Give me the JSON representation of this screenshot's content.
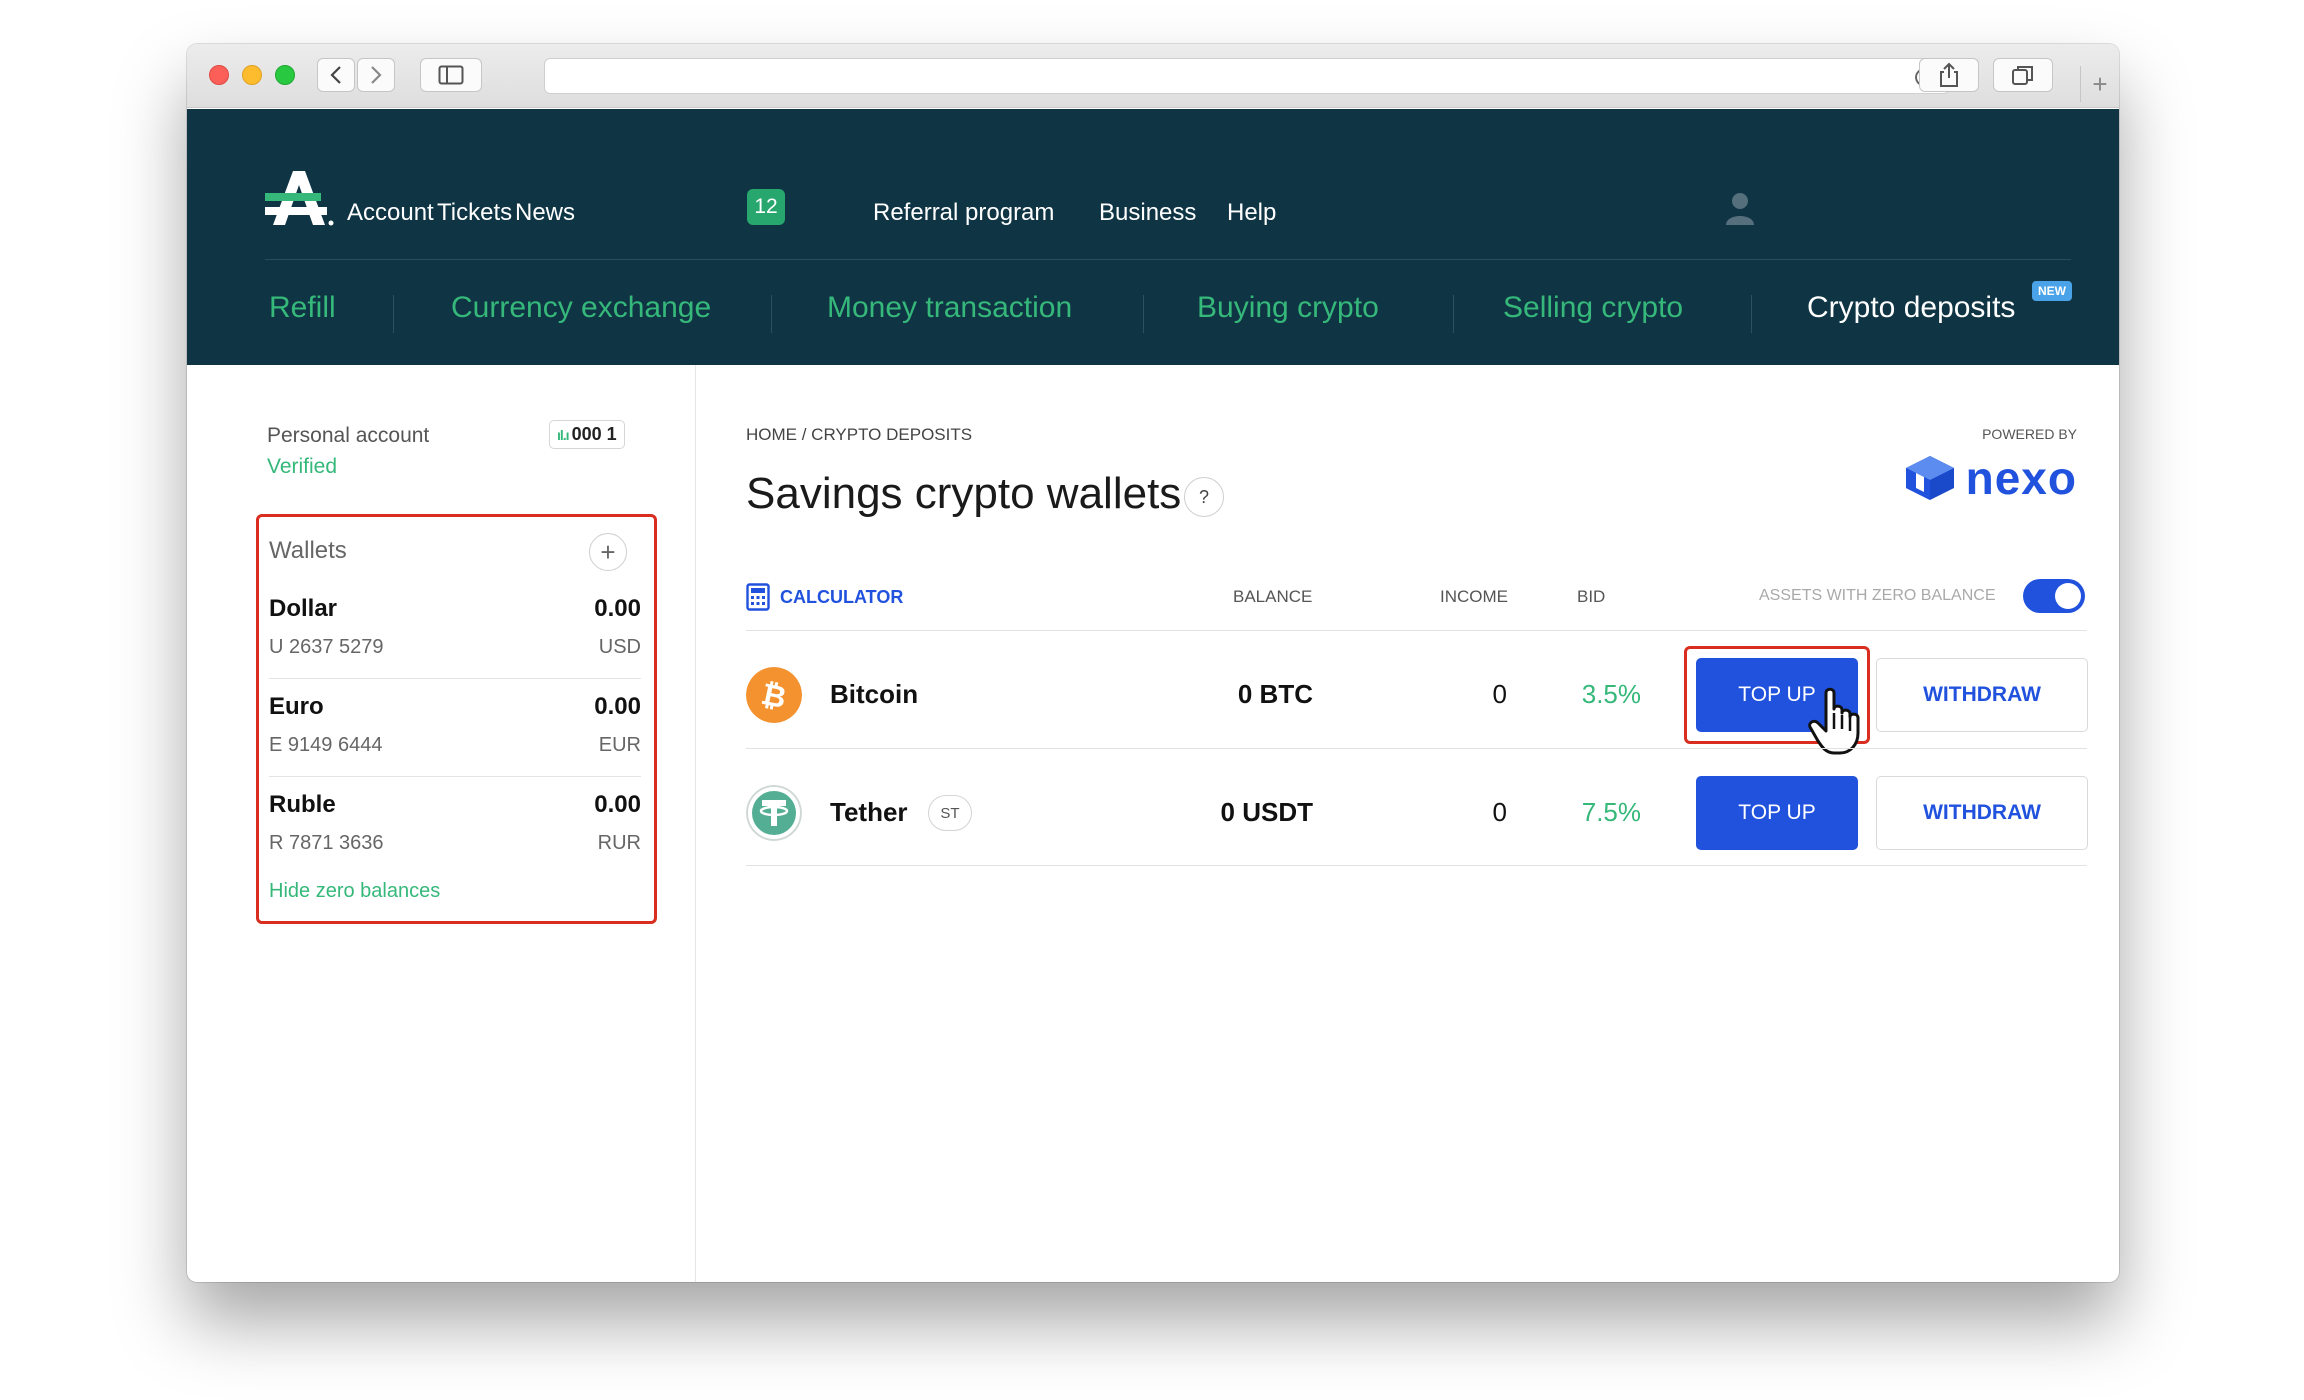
{
  "header": {
    "top_nav": [
      "Account",
      "Tickets",
      "News",
      "Referral program",
      "Business",
      "Help"
    ],
    "news_count": "12",
    "sub_nav": [
      "Refill",
      "Currency exchange",
      "Money transaction",
      "Buying crypto",
      "Selling crypto",
      "Crypto deposits"
    ],
    "new_badge": "NEW"
  },
  "account": {
    "label": "Personal account",
    "status": "Verified",
    "id_bars": "ıl.ı",
    "id": "000 1"
  },
  "wallets": {
    "title": "Wallets",
    "add": "+",
    "items": [
      {
        "name": "Dollar",
        "amount": "0.00",
        "number": "U 2637 5279",
        "currency": "USD"
      },
      {
        "name": "Euro",
        "amount": "0.00",
        "number": "E 9149 6444",
        "currency": "EUR"
      },
      {
        "name": "Ruble",
        "amount": "0.00",
        "number": "R 7871 3636",
        "currency": "RUR"
      }
    ],
    "hide_zero": "Hide zero balances"
  },
  "main": {
    "breadcrumb": "HOME / CRYPTO DEPOSITS",
    "title": "Savings crypto wallets",
    "help": "?",
    "powered_by": "POWERED BY",
    "partner": "nexo",
    "calculator": "CALCULATOR",
    "columns": {
      "balance": "BALANCE",
      "income": "INCOME",
      "bid": "BID"
    },
    "toggle_label": "ASSETS WITH ZERO BALANCE",
    "toggle_on": true,
    "assets": [
      {
        "name": "Bitcoin",
        "tag": "",
        "balance": "0 BTC",
        "income": "0",
        "bid": "3.5%",
        "top_up": "TOP UP",
        "withdraw": "WITHDRAW"
      },
      {
        "name": "Tether",
        "tag": "ST",
        "balance": "0 USDT",
        "income": "0",
        "bid": "7.5%",
        "top_up": "TOP UP",
        "withdraw": "WITHDRAW"
      }
    ]
  },
  "colors": {
    "header_bg": "#0f3545",
    "accent_green": "#35b87a",
    "primary_blue": "#2052de",
    "highlight_red": "#d92d1f"
  }
}
